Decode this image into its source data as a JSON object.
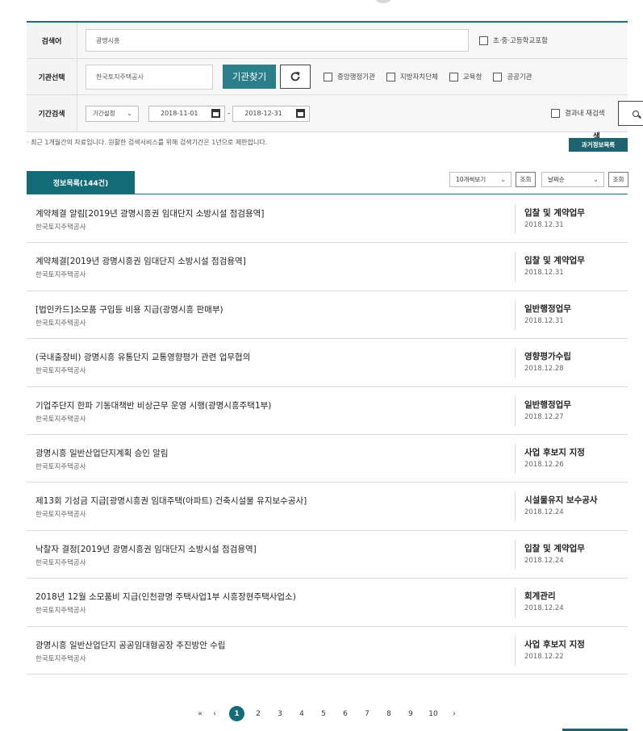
{
  "search": {
    "keyword_label": "검색어",
    "keyword_value": "광명시흥",
    "include_school_label": "초·중·고등학교포함",
    "agency_label": "기관선택",
    "agency_value": "한국토지주택공사",
    "find_agency_button": "기관찾기",
    "agency_types": [
      "중앙행정기관",
      "지방자치단체",
      "교육청",
      "공공기관"
    ],
    "period_label": "기간검색",
    "period_select": "기간설정",
    "date_from": "2018-11-01",
    "date_sep": "-",
    "date_to": "2018-12-31",
    "within_results_label": "결과내 재검색",
    "search_button": "검",
    "search_button_tail": "색"
  },
  "notice": "· 최근 1개월간의 자료입니다. 원활한 검색서비스를 위해 검색기간은 1년으로 제한합니다.",
  "old_info_button": "과거정보목록",
  "tab": {
    "label": "정보목록(144건)"
  },
  "controls": {
    "page_size": "10개씩보기",
    "view_button": "조회",
    "sort": "날짜순",
    "view_button2": "조회"
  },
  "items": [
    {
      "title": "계약체결 알림[2019년 광명시흥권 임대단지 소방시설 점검용역]",
      "org": "한국토지주택공사",
      "category": "입찰 및 계약업무",
      "date": "2018.12.31"
    },
    {
      "title": "계약체결[2019년 광명시흥권 임대단지 소방시설 점검용역]",
      "org": "한국토지주택공사",
      "category": "입찰 및 계약업무",
      "date": "2018.12.31"
    },
    {
      "title": "[법인카드]소모품 구입등 비용 지급(광명시흥 판매부)",
      "org": "한국토지주택공사",
      "category": "일반행정업무",
      "date": "2018.12.31"
    },
    {
      "title": "(국내출장비) 광명시흥 유통단지 교통영향평가 관련 업무협의",
      "org": "한국토지주택공사",
      "category": "영향평가수립",
      "date": "2018.12.28"
    },
    {
      "title": "기업주단지 한파 기동대책반 비상근무 운영 시행(광명시흥주택1부)",
      "org": "한국토지주택공사",
      "category": "일반행정업무",
      "date": "2018.12.27"
    },
    {
      "title": "광명시흥 일반산업단지계획 승인 알림",
      "org": "한국토지주택공사",
      "category": "사업 후보지 지정",
      "date": "2018.12.26"
    },
    {
      "title": "제13회 기성금 지급[광명시흥권 임대주택(아파트) 건축시설물 유지보수공사]",
      "org": "한국토지주택공사",
      "category": "시설물유지 보수공사",
      "date": "2018.12.24"
    },
    {
      "title": "낙찰자 결정[2019년 광명시흥권 임대단지 소방시설 점검용역]",
      "org": "한국토지주택공사",
      "category": "입찰 및 계약업무",
      "date": "2018.12.24"
    },
    {
      "title": "2018년 12월 소모품비 지급(인천광명 주택사업1부 시흥장현주택사업소)",
      "org": "한국토지주택공사",
      "category": "회계관리",
      "date": "2018.12.24"
    },
    {
      "title": "광명시흥 일반산업단지 공공임대형공장 추진방안 수립",
      "org": "한국토지주택공사",
      "category": "사업 후보지 지정",
      "date": "2018.12.22"
    }
  ],
  "pagination": {
    "first": "«",
    "prev": "‹",
    "pages": [
      "1",
      "2",
      "3",
      "4",
      "5",
      "6",
      "7",
      "8",
      "9",
      "10"
    ],
    "current": "1",
    "next": "›"
  }
}
